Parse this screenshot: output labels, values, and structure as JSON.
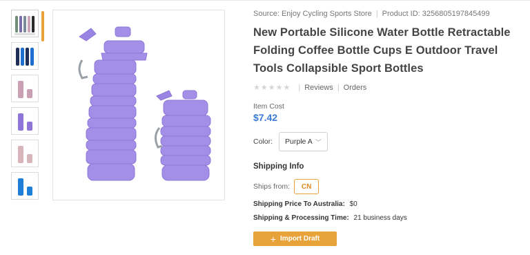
{
  "source": {
    "label": "Source: Enjoy Cycling Sports Store",
    "product_id": "Product ID: 3256805197845499"
  },
  "product": {
    "title": "New Portable Silicone Water Bottle Retractable Folding Coffee Bottle Cups E Outdoor Travel Tools Collapsible Sport Bottles"
  },
  "rating": {
    "stars_filled": 0,
    "stars_total": 5,
    "reviews_label": "Reviews",
    "orders_label": "Orders"
  },
  "cost": {
    "label": "Item Cost",
    "value": "$7.42"
  },
  "color": {
    "label": "Color:",
    "selected": "Purple A"
  },
  "shipping": {
    "heading": "Shipping Info",
    "ships_from_label": "Ships from:",
    "ships_from_value": "CN",
    "price_label": "Shipping Price To Australia:",
    "price_value": "$0",
    "time_label": "Shipping & Processing Time:",
    "time_value": "21 business days"
  },
  "actions": {
    "import_label": "Import Draft"
  },
  "thumbnails": [
    {
      "variant": "multi-color",
      "colors": [
        "#6f8f7a",
        "#7a6fa8",
        "#7b8a9a",
        "#c9a5b5",
        "#2a2a2a"
      ]
    },
    {
      "variant": "navy-blue",
      "colors": [
        "#1f2f5a",
        "#1f6fd0"
      ]
    },
    {
      "variant": "pink",
      "colors": [
        "#c9a0b4"
      ]
    },
    {
      "variant": "purple",
      "colors": [
        "#8f75d9"
      ]
    },
    {
      "variant": "light-pink",
      "colors": [
        "#d8b4bb"
      ]
    },
    {
      "variant": "blue",
      "colors": [
        "#1f7fd8"
      ]
    }
  ],
  "colors": {
    "accent": "#e8a23a",
    "price": "#3a7bd5",
    "bottle": "#a38ee8"
  }
}
